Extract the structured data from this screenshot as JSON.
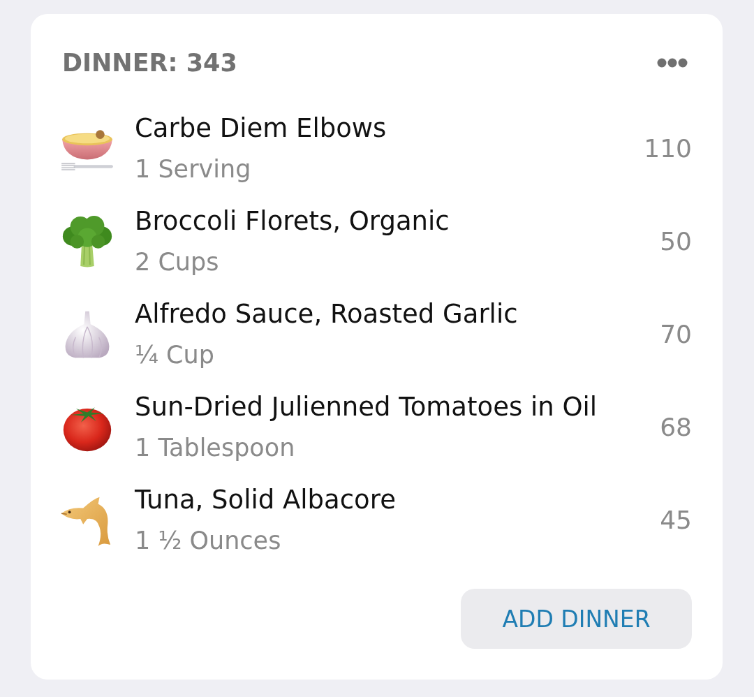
{
  "card": {
    "title": "DINNER: 343",
    "foods": [
      {
        "name": "Carbe Diem Elbows",
        "serving": "1 Serving",
        "calories": "110"
      },
      {
        "name": "Broccoli Florets, Organic",
        "serving": "2 Cups",
        "calories": "50"
      },
      {
        "name": "Alfredo Sauce, Roasted Garlic",
        "serving": "¼ Cup",
        "calories": "70"
      },
      {
        "name": "Sun-Dried Julienned Tomatoes in Oil",
        "serving": "1 Tablespoon",
        "calories": "68"
      },
      {
        "name": "Tuna, Solid Albacore",
        "serving": "1 ½ Ounces",
        "calories": "45"
      }
    ],
    "add_button": "ADD DINNER"
  }
}
